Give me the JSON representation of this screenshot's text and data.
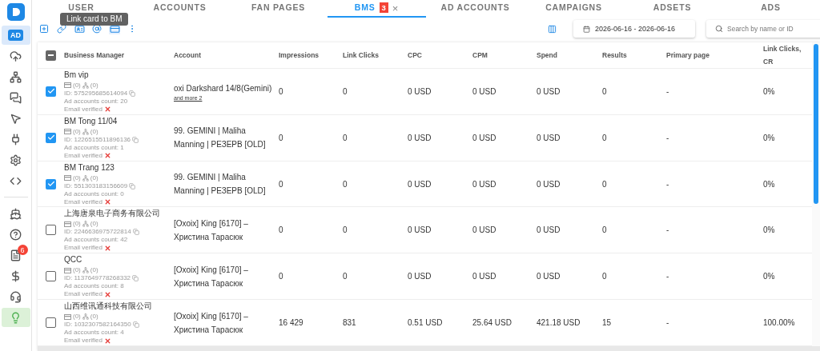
{
  "sidebar": {
    "top_items": [
      {
        "label": "AD",
        "selected": true
      },
      {
        "selected": false
      },
      {
        "selected": false
      },
      {
        "selected": false
      },
      {
        "selected": false
      },
      {
        "selected": false
      },
      {
        "selected": false
      },
      {
        "selected": false
      }
    ],
    "bottom_items": [
      {
        "selected": false
      },
      {
        "selected": false
      },
      {
        "badge": "6",
        "selected": false
      },
      {
        "selected": false
      },
      {
        "selected": false
      },
      {
        "selected": true
      }
    ]
  },
  "tabs": [
    {
      "label": "USER",
      "selected": false
    },
    {
      "label": "ACCOUNTS",
      "selected": false
    },
    {
      "label": "FAN PAGES",
      "selected": false
    },
    {
      "label": "BMS",
      "badge": "3",
      "close": "×",
      "selected": true
    },
    {
      "label": "AD ACCOUNTS",
      "selected": false
    },
    {
      "label": "CAMPAIGNS",
      "selected": false
    },
    {
      "label": "ADSETS",
      "selected": false
    },
    {
      "label": "ADS",
      "selected": false
    }
  ],
  "tooltip": "Link card to BM",
  "toolbar": {
    "date_range": "2026-06-16 - 2026-06-16",
    "search": {
      "placeholder": "Search by name or ID"
    }
  },
  "table": {
    "select_all": {
      "indeterminate": true
    },
    "fixed_columns": [
      "Business Manager",
      "Account"
    ],
    "columns": [
      "Impressions",
      "Link Clicks",
      "CPC",
      "CPM",
      "Spend",
      "Results",
      "Primary page",
      "Link Clicks, CR"
    ],
    "rows": [
      {
        "selected": true,
        "name": "Bm vip",
        "cards": "(0)",
        "members": "(0)",
        "id": "ID: 575295685614094",
        "ad_accounts": "Ad accounts count: 20",
        "email": "Email verified",
        "email_verified": false,
        "account": "oxi Darkshard 14/8(Gemini)",
        "more": "and more 2",
        "cells": [
          "0",
          "0",
          "0 USD",
          "0 USD",
          "0 USD",
          "0",
          "-",
          "0%"
        ]
      },
      {
        "selected": true,
        "name": "BM Tong 11/04",
        "cards": "(0)",
        "members": "(0)",
        "id": "ID: 1226515511896136",
        "ad_accounts": "Ad accounts count: 1",
        "email": "Email verified",
        "email_verified": false,
        "account": "99. GEMINI | Maliha Manning | РЕЗЕРВ [OLD]",
        "cells": [
          "0",
          "0",
          "0 USD",
          "0 USD",
          "0 USD",
          "0",
          "-",
          "0%"
        ]
      },
      {
        "selected": true,
        "name": "BM Trang 123",
        "cards": "(0)",
        "members": "(0)",
        "id": "ID: 551303183156609",
        "ad_accounts": "Ad accounts count: 0",
        "email": "Email verified",
        "email_verified": false,
        "account": "99. GEMINI | Maliha Manning | РЕЗЕРВ [OLD]",
        "cells": [
          "0",
          "0",
          "0 USD",
          "0 USD",
          "0 USD",
          "0",
          "-",
          "0%"
        ]
      },
      {
        "selected": false,
        "name": "上海唐泉电子商务有限公司",
        "cards": "(0)",
        "members": "(0)",
        "id": "ID: 2246636975722814",
        "ad_accounts": "Ad accounts count: 42",
        "email": "Email verified",
        "email_verified": false,
        "account": "[Oxoix] King [6170] – Христина Тарасюк",
        "cells": [
          "0",
          "0",
          "0 USD",
          "0 USD",
          "0 USD",
          "0",
          "-",
          "0%"
        ]
      },
      {
        "selected": false,
        "name": "QCC",
        "cards": "(0)",
        "members": "(0)",
        "id": "ID: 1137649778268332",
        "ad_accounts": "Ad accounts count: 8",
        "email": "Email verified",
        "email_verified": false,
        "account": "[Oxoix] King [6170] – Христина Тарасюк",
        "cells": [
          "0",
          "0",
          "0 USD",
          "0 USD",
          "0 USD",
          "0",
          "-",
          "0%"
        ]
      },
      {
        "selected": false,
        "name": "山西维讯通科技有限公司",
        "cards": "(0)",
        "members": "(0)",
        "id": "ID: 1032307582164350",
        "ad_accounts": "Ad accounts count: 4",
        "email": "Email verified",
        "email_verified": false,
        "account": "[Oxoix] King [6170] – Христина Тарасюк",
        "cells": [
          "16 429",
          "831",
          "0.51 USD",
          "25.64 USD",
          "421.18 USD",
          "15",
          "-",
          "100.00%"
        ]
      }
    ]
  }
}
